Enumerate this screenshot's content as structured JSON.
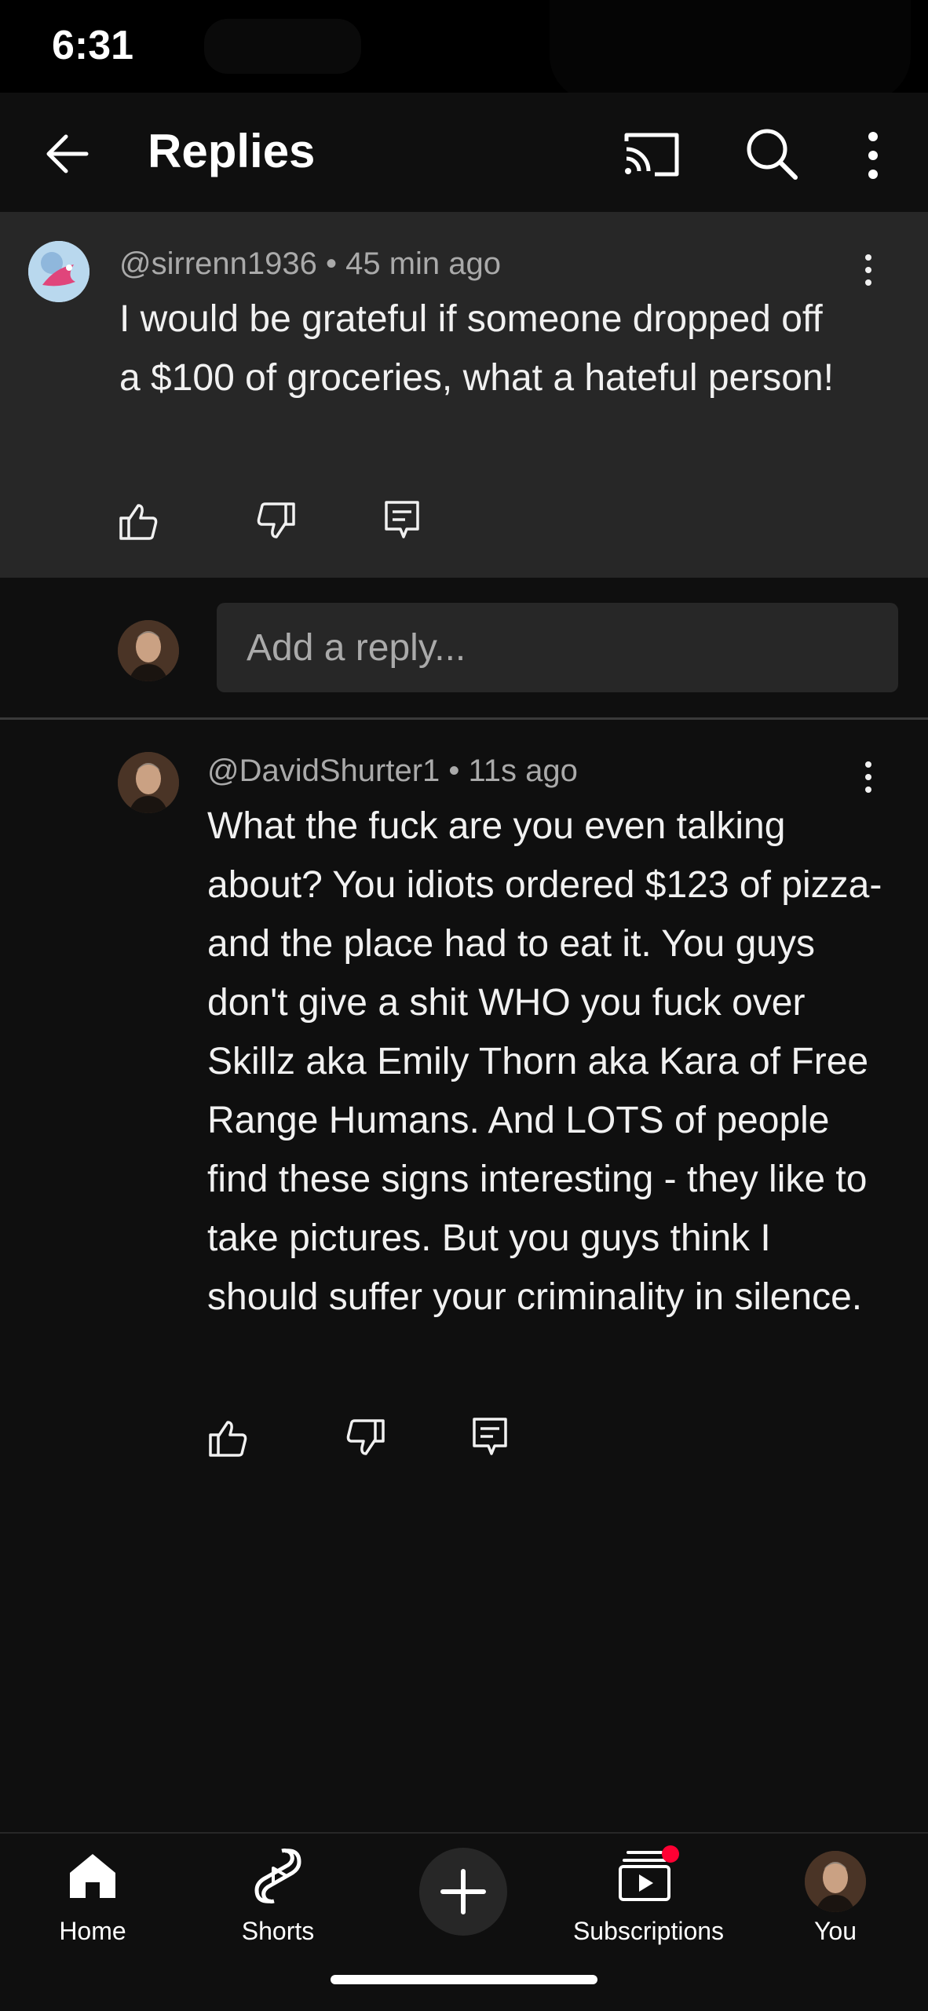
{
  "status_bar": {
    "time": "6:31"
  },
  "header": {
    "title": "Replies",
    "icons": [
      "back-arrow-icon",
      "cast-icon",
      "search-icon",
      "more-vert-icon"
    ]
  },
  "parent_comment": {
    "author": "@sirrenn1936",
    "age": "45 min ago",
    "text": "I would be grateful if someone dropped off a $100 of groceries, what a hateful person!",
    "actions": [
      "like-icon",
      "dislike-icon",
      "reply-icon"
    ]
  },
  "reply_input": {
    "placeholder": "Add a reply..."
  },
  "reply_comment": {
    "author": "@DavidShurter1",
    "age": "11s ago",
    "text": "What the fuck are you even talking about? You idiots ordered $123 of pizza- and the place had to eat it. You guys don't give a shit WHO you fuck over Skillz aka Emily Thorn aka Kara of Free Range Humans. And LOTS of people find these signs interesting - they like to take pictures. But you guys think I should suffer your criminality in silence.",
    "actions": [
      "like-icon",
      "dislike-icon",
      "reply-icon"
    ]
  },
  "bottom_nav": {
    "items": [
      {
        "label": "Home",
        "icon": "home-icon"
      },
      {
        "label": "Shorts",
        "icon": "shorts-icon"
      },
      {
        "label": "",
        "icon": "create-plus-icon"
      },
      {
        "label": "Subscriptions",
        "icon": "subscriptions-icon"
      },
      {
        "label": "You",
        "icon": "avatar"
      }
    ],
    "notification_color": "#ff0033"
  },
  "colors": {
    "background": "#0f0f0f",
    "surface": "#272727",
    "text": "#f1f1f1",
    "secondary_text": "#aaaaaa"
  }
}
